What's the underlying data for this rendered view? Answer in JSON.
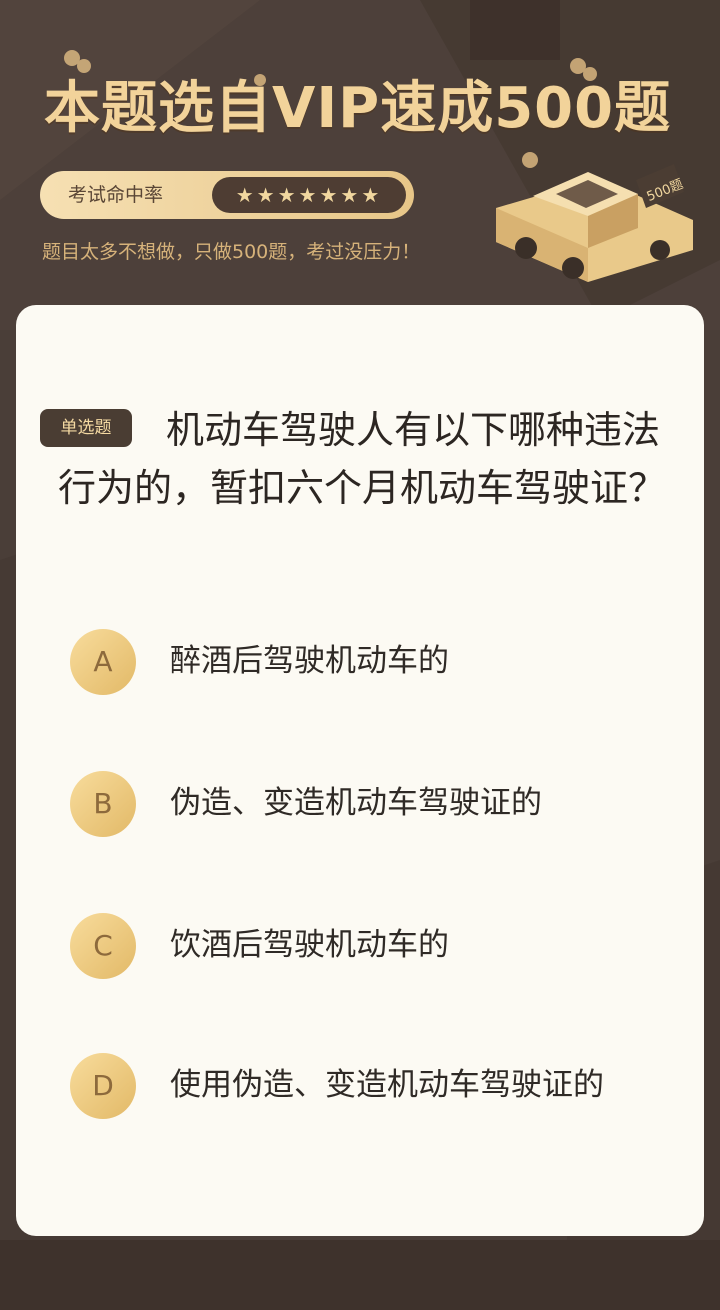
{
  "header": {
    "headline": "本题选自VIP速成500题",
    "hit_rate_label": "考试命中率",
    "hit_rate_stars": "★★★★★★★",
    "star_count": 7,
    "subtitle": "题目太多不想做，只做500题，考过没压力！",
    "car_sign": "500题"
  },
  "question": {
    "type_label": "单选题",
    "text": "机动车驾驶人有以下哪种违法行为的，暂扣六个月机动车驾驶证？",
    "options": [
      {
        "letter": "A",
        "text": "醉酒后驾驶机动车的"
      },
      {
        "letter": "B",
        "text": "伪造、变造机动车驾驶证的"
      },
      {
        "letter": "C",
        "text": "饮酒后驾驶机动车的"
      },
      {
        "letter": "D",
        "text": "使用伪造、变造机动车驾驶证的"
      }
    ]
  },
  "colors": {
    "background": "#4a3e38",
    "gold": "#f2d39a",
    "card": "#fcfaf3",
    "option_circle": "#e9c57a",
    "text": "#2c2622"
  }
}
